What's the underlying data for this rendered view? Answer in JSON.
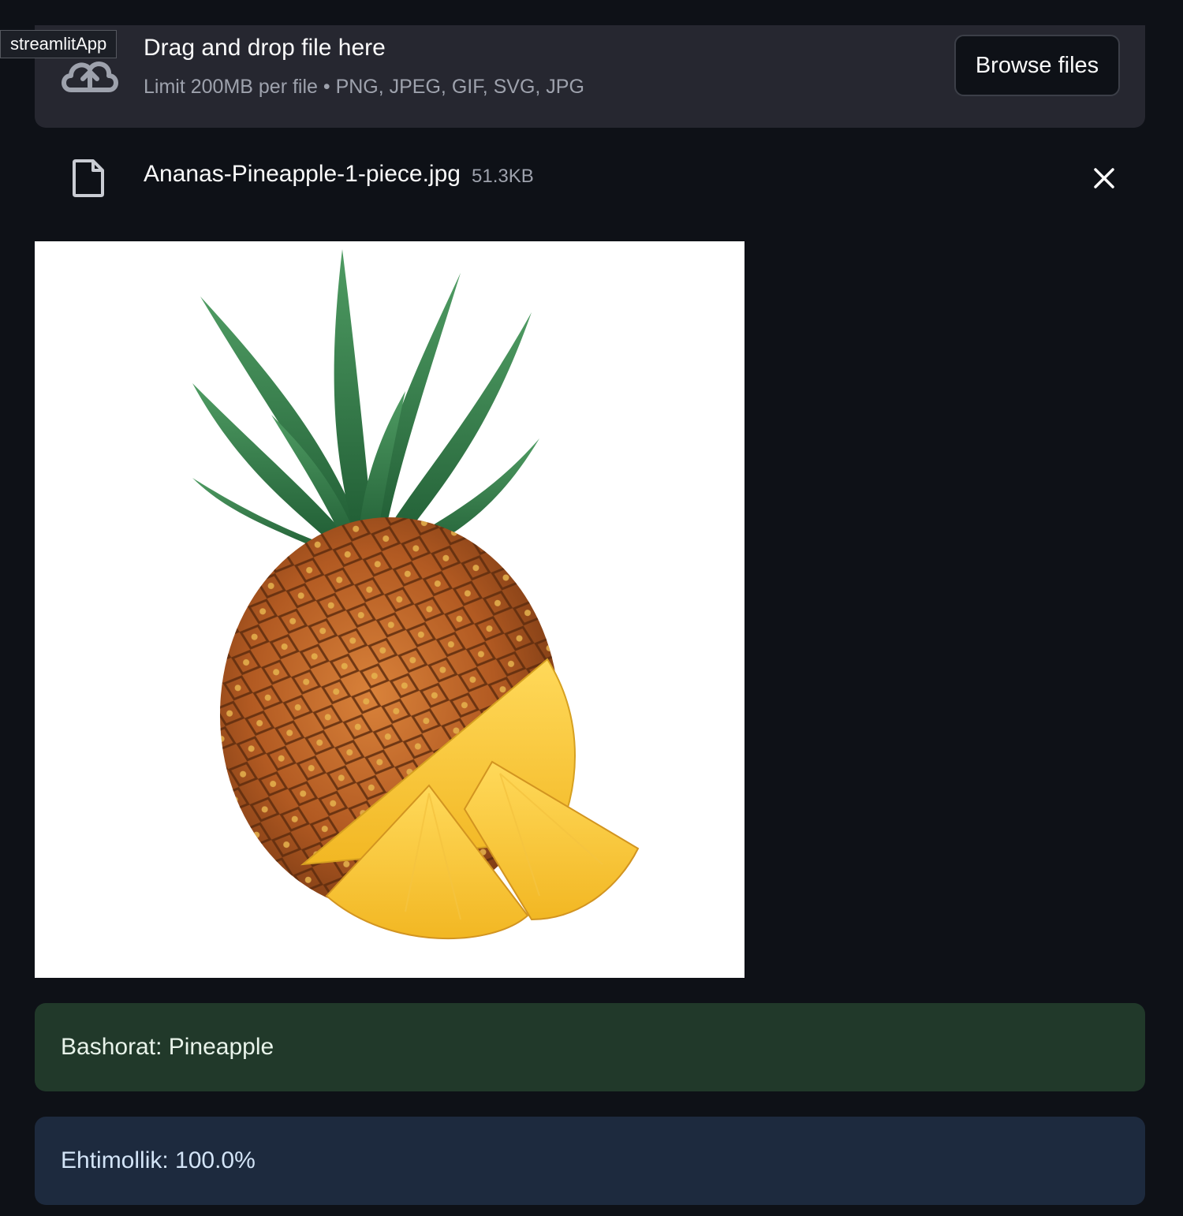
{
  "tooltip": {
    "label": "streamlitApp"
  },
  "uploader": {
    "title": "Drag and drop file here",
    "subtitle": "Limit 200MB per file • PNG, JPEG, GIF, SVG, JPG",
    "browse_label": "Browse files",
    "icon": "cloud-upload-icon"
  },
  "file": {
    "name": "Ananas-Pineapple-1-piece.jpg",
    "size": "51.3KB",
    "icon": "file-icon",
    "remove_icon": "close-icon"
  },
  "image": {
    "subject": "pineapple-with-slices"
  },
  "results": {
    "prediction": "Bashorat: Pineapple",
    "probability": "Ehtimollik: 100.0%"
  },
  "colors": {
    "background": "#0e1117",
    "dropzone": "#262730",
    "success_bg": "#21392a",
    "info_bg": "#1d2a3e"
  }
}
